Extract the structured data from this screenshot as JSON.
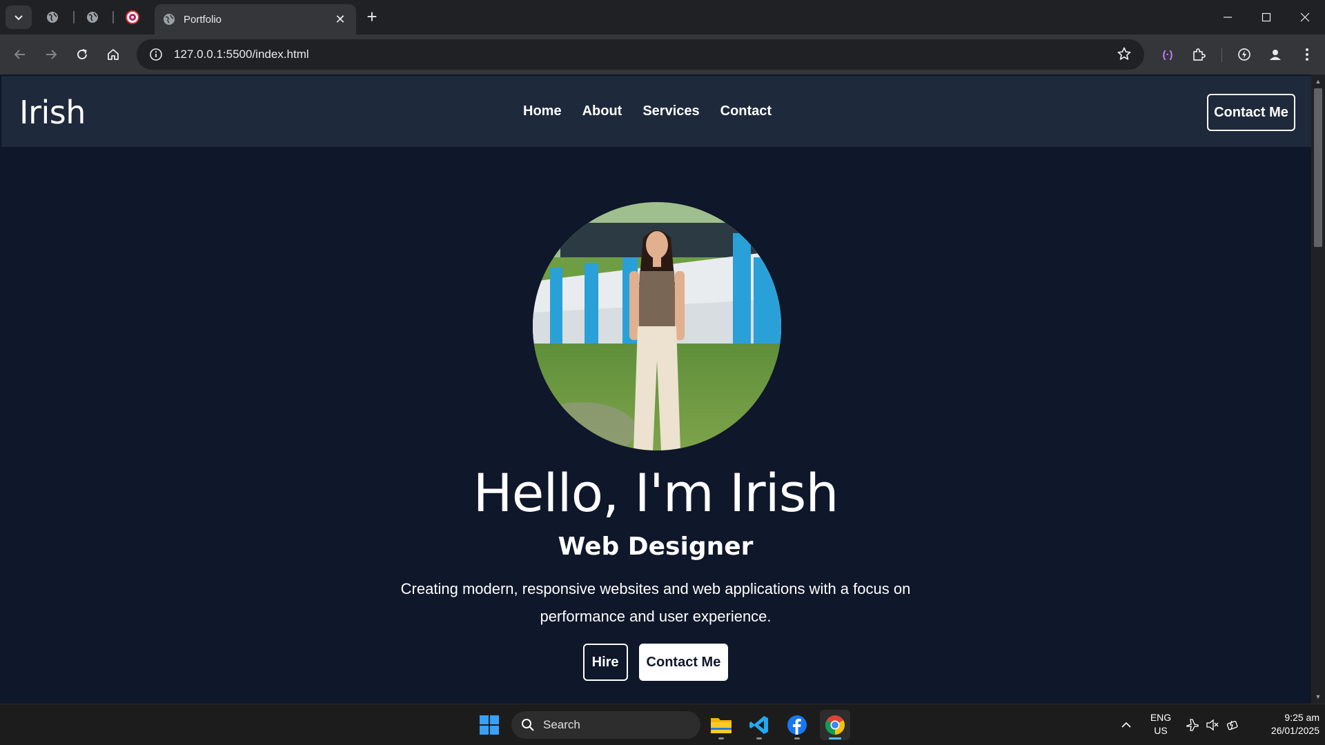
{
  "browser": {
    "pinned_tabs": [
      "globe",
      "globe",
      "favicon"
    ],
    "active_tab": {
      "title": "Portfolio"
    },
    "address": "127.0.0.1:5500/index.html"
  },
  "site": {
    "brand": "Irish",
    "nav": [
      "Home",
      "About",
      "Services",
      "Contact"
    ],
    "nav_cta": "Contact Me",
    "hero": {
      "title": "Hello, I'm Irish",
      "subtitle": "Web Designer",
      "description": "Creating modern, responsive websites and web applications with a focus on performance and user experience.",
      "primary_button": "Hire",
      "secondary_button": "Contact Me"
    },
    "colors": {
      "page_bg": "#0f172a",
      "nav_bg": "#1e293b",
      "text": "#ffffff"
    }
  },
  "taskbar": {
    "search_placeholder": "Search",
    "language": {
      "line1": "ENG",
      "line2": "US"
    },
    "time": "9:25 am",
    "date": "26/01/2025",
    "apps": [
      "windows-start",
      "file-explorer",
      "vscode",
      "facebook",
      "chrome"
    ]
  }
}
